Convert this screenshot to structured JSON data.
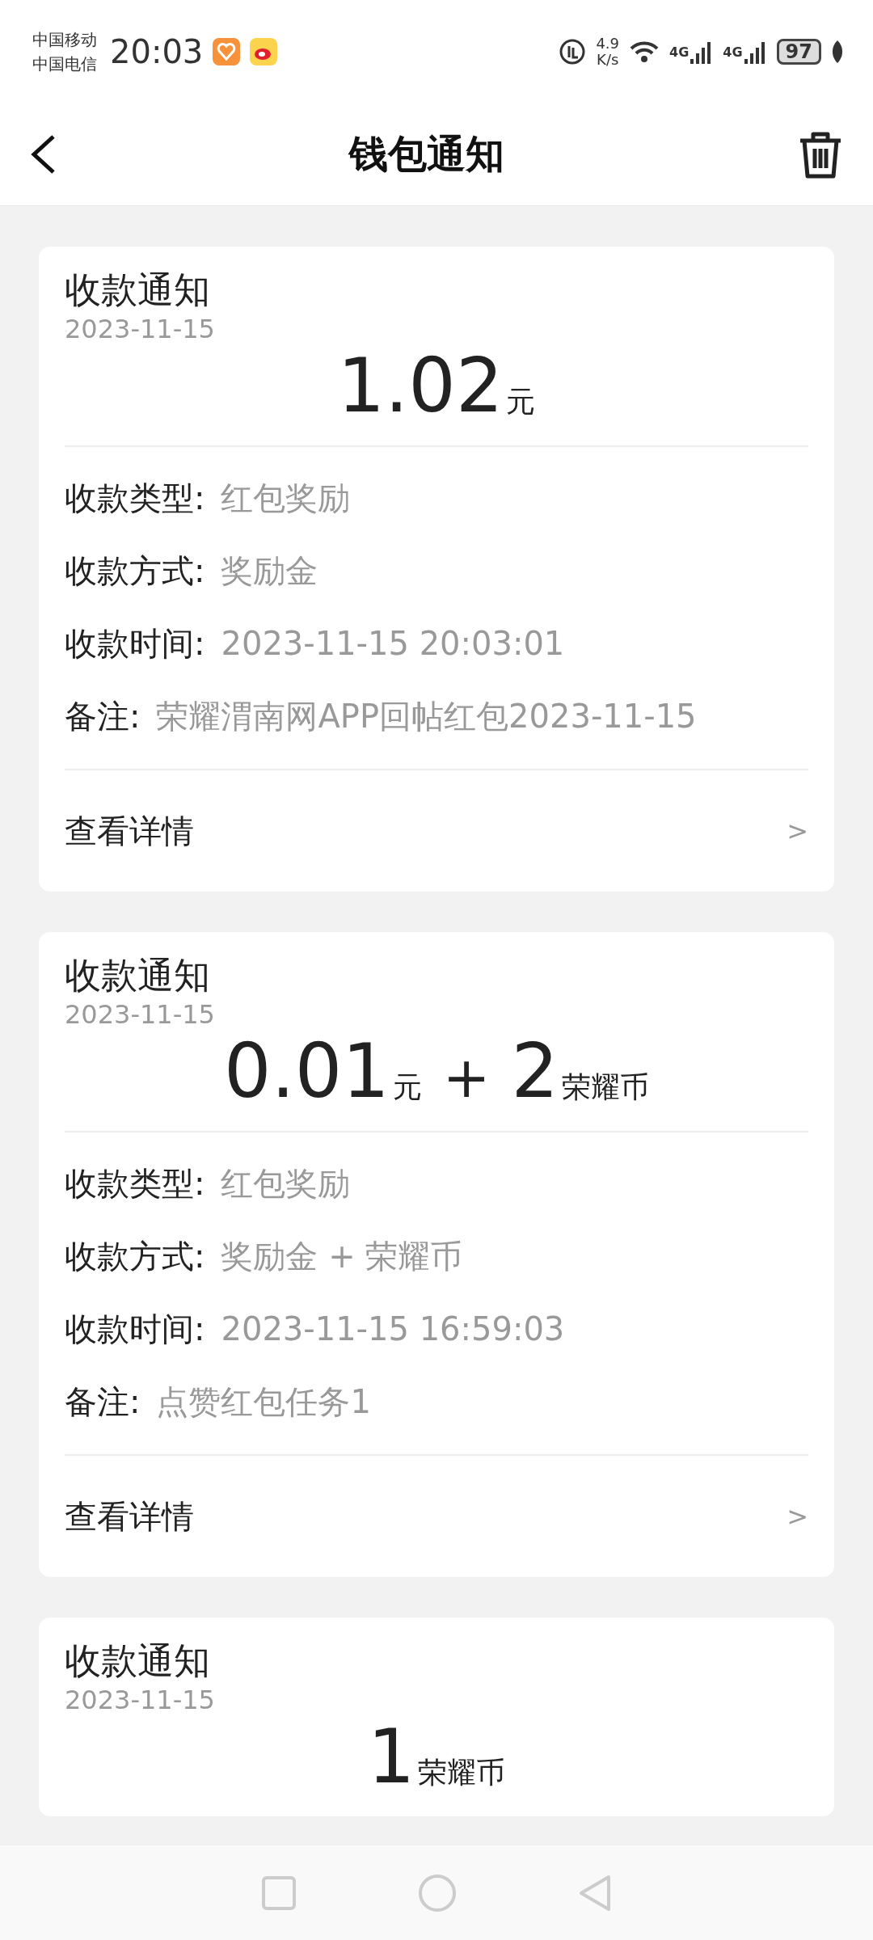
{
  "status_bar": {
    "carriers": [
      "中国移动",
      "中国电信"
    ],
    "time": "20:03",
    "speed": [
      "4.9",
      "K/s"
    ],
    "networks": [
      "4G",
      "4G"
    ],
    "battery": "97"
  },
  "header": {
    "title": "钱包通知"
  },
  "cards": [
    {
      "title": "收款通知",
      "date": "2023-11-15",
      "amount": [
        {
          "kind": "number",
          "text": "1.02"
        },
        {
          "kind": "unit",
          "text": "元"
        }
      ],
      "fields": [
        {
          "label": "收款类型:",
          "value": "红包奖励"
        },
        {
          "label": "收款方式:",
          "value": "奖励金"
        },
        {
          "label": "收款时间:",
          "value": "2023-11-15 20:03:01"
        },
        {
          "label": "备注:",
          "value": "荣耀渭南网APP回帖红包2023-11-15"
        }
      ],
      "link": {
        "label": "查看详情",
        "arrow": ">"
      }
    },
    {
      "title": "收款通知",
      "date": "2023-11-15",
      "amount": [
        {
          "kind": "number",
          "text": "0.01"
        },
        {
          "kind": "unit",
          "text": "元"
        },
        {
          "kind": "operator",
          "text": "+"
        },
        {
          "kind": "number",
          "text": "2"
        },
        {
          "kind": "unit",
          "text": "荣耀币"
        }
      ],
      "fields": [
        {
          "label": "收款类型:",
          "value": "红包奖励"
        },
        {
          "label": "收款方式:",
          "value": "奖励金 + 荣耀币"
        },
        {
          "label": "收款时间:",
          "value": "2023-11-15 16:59:03"
        },
        {
          "label": "备注:",
          "value": "点赞红包任务1"
        }
      ],
      "link": {
        "label": "查看详情",
        "arrow": ">"
      }
    },
    {
      "title": "收款通知",
      "date": "2023-11-15",
      "amount": [
        {
          "kind": "number",
          "text": "1"
        },
        {
          "kind": "unit",
          "text": "荣耀币"
        }
      ]
    }
  ]
}
